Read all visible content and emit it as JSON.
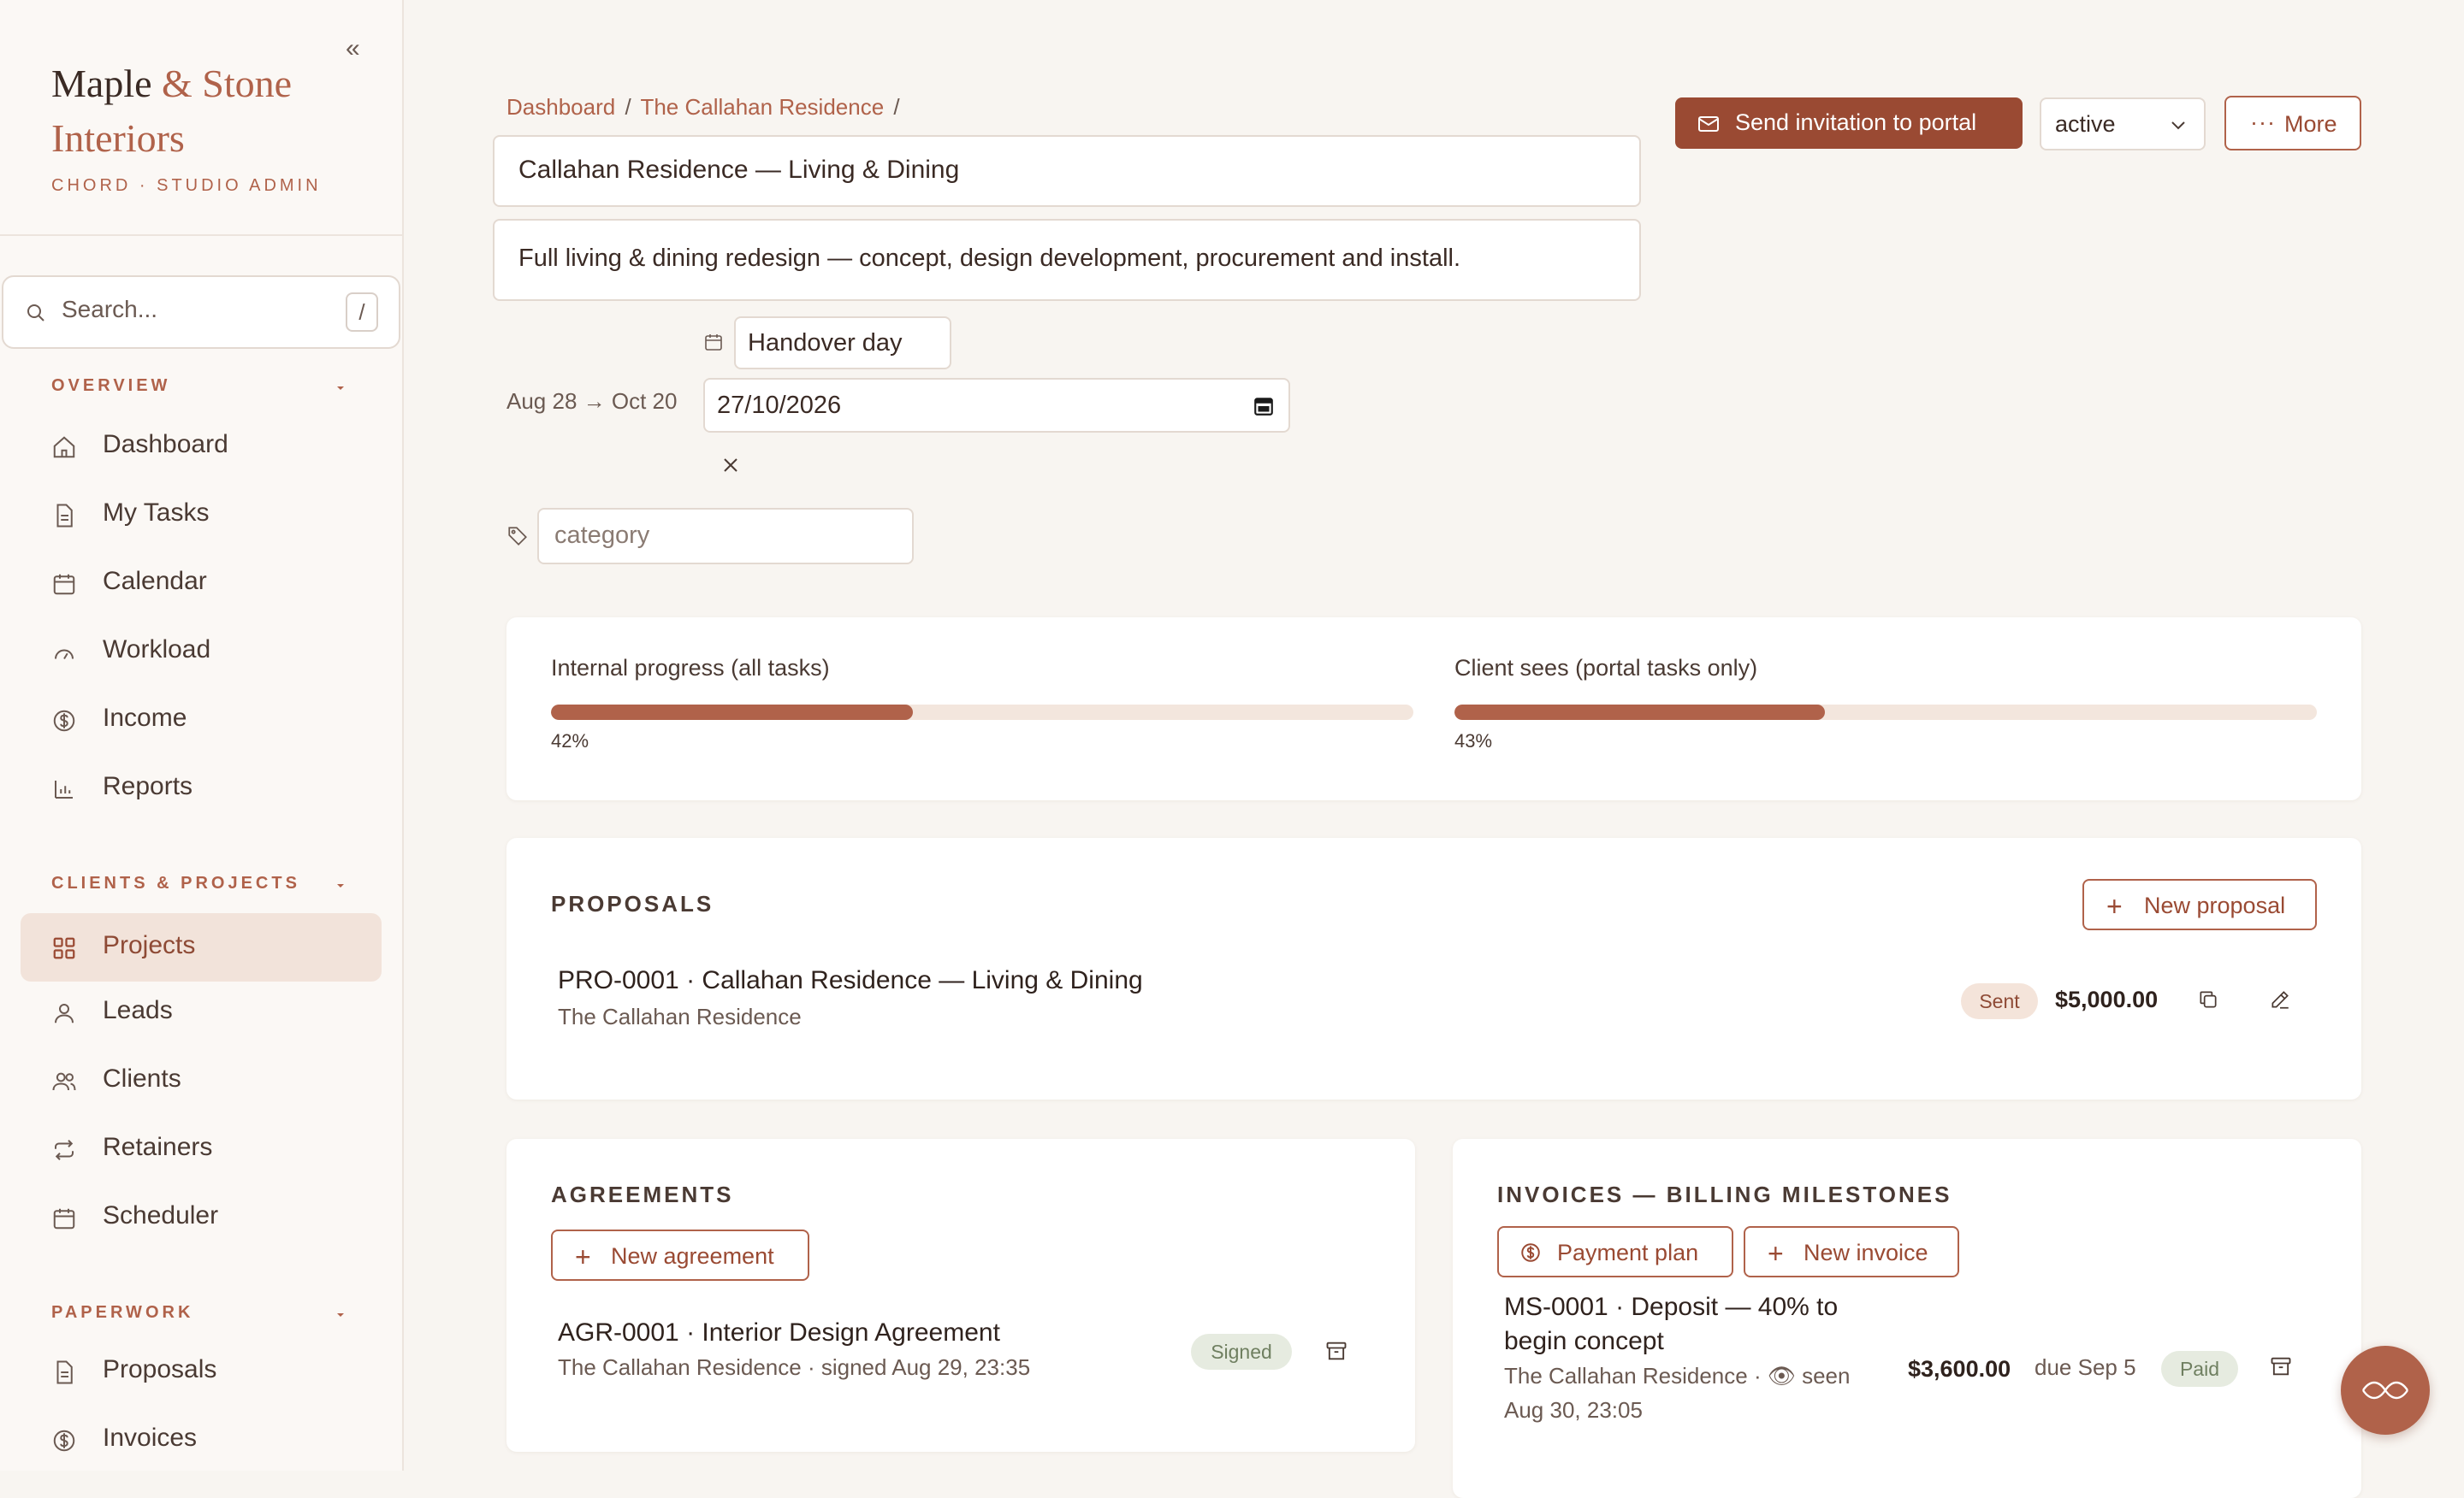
{
  "brand": {
    "name_part1": "Maple",
    "name_amp": "& Stone",
    "name_part2": "Interiors",
    "subtitle": "CHORD · STUDIO ADMIN"
  },
  "sidebar": {
    "collapse_glyph": "«",
    "search_placeholder": "Search...",
    "search_shortcut": "/",
    "sections": {
      "overview": "OVERVIEW",
      "clients_projects": "CLIENTS & PROJECTS",
      "paperwork": "PAPERWORK"
    },
    "items": [
      {
        "label": "Dashboard",
        "icon": "home-icon"
      },
      {
        "label": "My Tasks",
        "icon": "document-icon"
      },
      {
        "label": "Calendar",
        "icon": "calendar-icon"
      },
      {
        "label": "Workload",
        "icon": "gauge-icon"
      },
      {
        "label": "Income",
        "icon": "dollar-icon"
      },
      {
        "label": "Reports",
        "icon": "bar-chart-icon"
      },
      {
        "label": "Projects",
        "icon": "grid-icon",
        "active": true
      },
      {
        "label": "Leads",
        "icon": "user-icon"
      },
      {
        "label": "Clients",
        "icon": "users-icon"
      },
      {
        "label": "Retainers",
        "icon": "repeat-icon"
      },
      {
        "label": "Scheduler",
        "icon": "calendar-icon"
      },
      {
        "label": "Proposals",
        "icon": "document-icon"
      },
      {
        "label": "Invoices",
        "icon": "dollar-icon"
      }
    ]
  },
  "header": {
    "breadcrumb": [
      "Dashboard",
      "The Callahan Residence"
    ],
    "breadcrumb_sep": "/",
    "title": "Callahan Residence — Living & Dining",
    "description": "Full living & dining redesign — concept, design development, procurement and install.",
    "send_invite_label": "Send invitation to portal",
    "status_value": "active",
    "more_label": "More"
  },
  "dates": {
    "handover_label": "Handover day",
    "range": "Aug 28 → Oct 20",
    "date_value": "27/10/2026",
    "category_placeholder": "category"
  },
  "progress": {
    "internal": {
      "label": "Internal progress (all tasks)",
      "percent": 42,
      "display": "42%"
    },
    "client": {
      "label": "Client sees (portal tasks only)",
      "percent": 43,
      "display": "43%"
    }
  },
  "proposals": {
    "title": "PROPOSALS",
    "new_label": "New proposal",
    "items": [
      {
        "title": "PRO-0001 · Callahan Residence — Living & Dining",
        "subtitle": "The Callahan Residence",
        "status": "Sent",
        "amount": "$5,000.00"
      }
    ]
  },
  "agreements": {
    "title": "AGREEMENTS",
    "new_label": "New agreement",
    "items": [
      {
        "title": "AGR-0001 · Interior Design Agreement",
        "subtitle": "The Callahan Residence · signed Aug 29, 23:35",
        "status": "Signed"
      }
    ]
  },
  "invoices": {
    "title": "INVOICES — BILLING MILESTONES",
    "payment_plan_label": "Payment plan",
    "new_label": "New invoice",
    "items": [
      {
        "title_line1": "MS-0001 · Deposit — 40% to",
        "title_line2": "begin concept",
        "subtitle_line1": "The Callahan Residence · 👁 seen",
        "subtitle_line2": "Aug 30, 23:05",
        "amount": "$3,600.00",
        "due": "due Sep 5",
        "status": "Paid"
      }
    ]
  },
  "colors": {
    "accent": "#b0624a",
    "accent_dark": "#9a4a33",
    "background": "#f8f5f1",
    "active_nav_bg": "#f2e3da",
    "progress_track": "#f3e6dd",
    "badge_sent_bg": "#f4e4da",
    "badge_ok_bg": "#e6ebe0"
  }
}
